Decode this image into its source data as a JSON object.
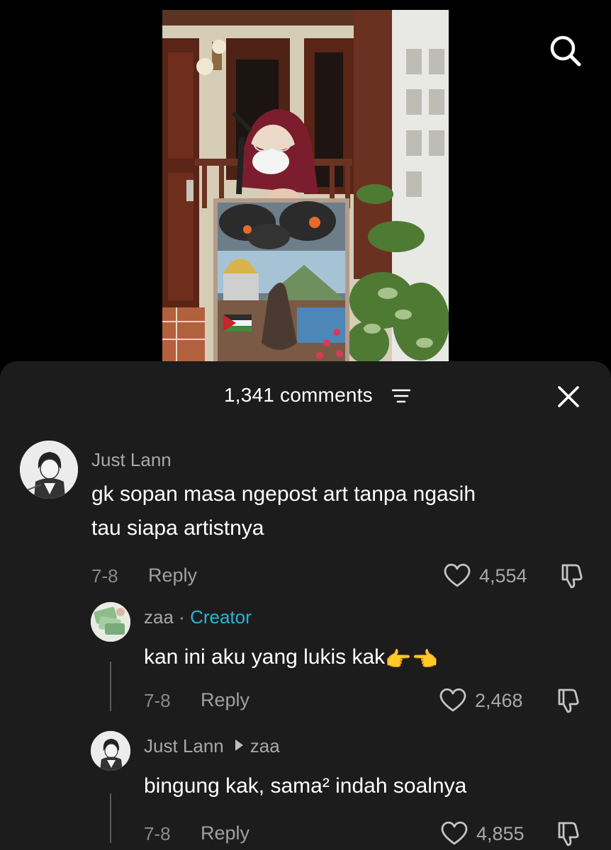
{
  "header": {
    "comment_count": "1,341 comments"
  },
  "comments": [
    {
      "username": "Just Lann",
      "text_line1": "gk sopan masa ngepost art tanpa ngasih",
      "text_line2": "tau siapa artistnya",
      "date": "7-8",
      "reply_label": "Reply",
      "likes": "4,554"
    },
    {
      "username": "zaa",
      "separator": "·",
      "badge": "Creator",
      "text": "kan ini aku yang lukis kak",
      "emoji": "👉👈",
      "date": "7-8",
      "reply_label": "Reply",
      "likes": "2,468"
    },
    {
      "username": "Just Lann",
      "reply_to": "zaa",
      "text": "bingung kak, sama² indah soalnya",
      "date": "7-8",
      "reply_label": "Reply",
      "likes": "4,855"
    }
  ],
  "colors": {
    "sheet_bg": "#1c1c1c",
    "creator_badge": "#2bb3d8",
    "muted_text": "#a8a8a8"
  },
  "icons": [
    "search-icon",
    "sort-icon",
    "close-icon",
    "heart-icon",
    "dislike-icon",
    "reply-arrow-icon"
  ]
}
